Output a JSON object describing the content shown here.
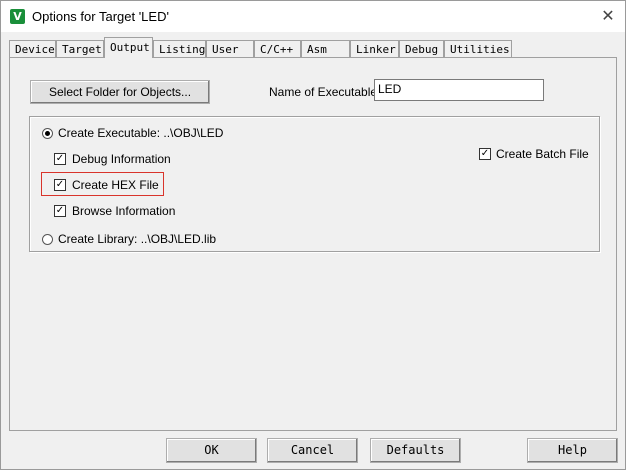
{
  "window": {
    "title": "Options for Target 'LED'",
    "icon": "keil-uvision-icon",
    "close_glyph": "✕"
  },
  "tabs": [
    {
      "label": "Device"
    },
    {
      "label": "Target"
    },
    {
      "label": "Output",
      "active": true
    },
    {
      "label": "Listing"
    },
    {
      "label": "User"
    },
    {
      "label": "C/C++"
    },
    {
      "label": "Asm"
    },
    {
      "label": "Linker"
    },
    {
      "label": "Debug"
    },
    {
      "label": "Utilities"
    }
  ],
  "output": {
    "select_folder_label": "Select Folder for Objects...",
    "name_label": "Name of Executable:",
    "name_value": "LED",
    "create_executable": {
      "label": "Create Executable:  ..\\OBJ\\LED",
      "selected": true
    },
    "debug_information": {
      "label": "Debug Information",
      "checked": true
    },
    "create_hex": {
      "label": "Create HEX File",
      "checked": true,
      "highlighted": true
    },
    "browse_information": {
      "label": "Browse Information",
      "checked": true
    },
    "create_library": {
      "label": "Create Library:  ..\\OBJ\\LED.lib",
      "selected": false
    },
    "create_batch": {
      "label": "Create Batch File",
      "checked": true
    },
    "check_glyph": "✓"
  },
  "buttons": {
    "ok": "OK",
    "cancel": "Cancel",
    "defaults": "Defaults",
    "help": "Help"
  },
  "colors": {
    "highlight": "#d9342b",
    "icon_bg": "#1a8f3a"
  }
}
